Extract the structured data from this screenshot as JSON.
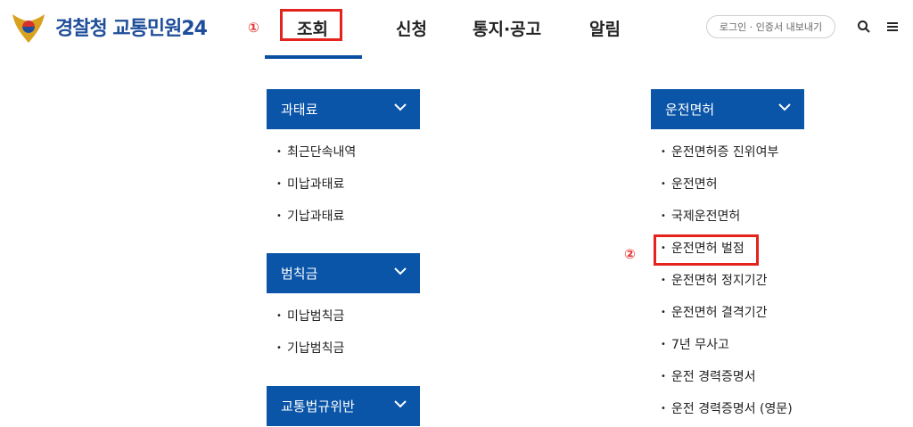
{
  "header": {
    "logo_text": "경찰청 교통민원24",
    "marker_1": "①",
    "nav": [
      "조회",
      "신청",
      "통지·공고",
      "알림"
    ],
    "util_label": "로그인 · 인증서 내보내기",
    "icons": [
      "search-icon",
      "menu-icon"
    ]
  },
  "left": {
    "groups": [
      {
        "title": "과태료",
        "items": [
          "최근단속내역",
          "미납과태료",
          "기납과태료"
        ]
      },
      {
        "title": "범칙금",
        "items": [
          "미납범칙금",
          "기납범칙금"
        ]
      },
      {
        "title": "교통법규위반",
        "items": []
      }
    ]
  },
  "right": {
    "marker_2": "②",
    "group": {
      "title": "운전면허",
      "items": [
        "운전면허증 진위여부",
        "운전면허",
        "국제운전면허",
        "운전면허 벌점",
        "운전면허 정지기간",
        "운전면허 결격기간",
        "7년 무사고",
        "운전 경력증명서",
        "운전 경력증명서 (영문)"
      ]
    }
  },
  "colors": {
    "accent": "#0a55a8",
    "highlight": "#e3231c",
    "logo": "#1f4e9a"
  }
}
